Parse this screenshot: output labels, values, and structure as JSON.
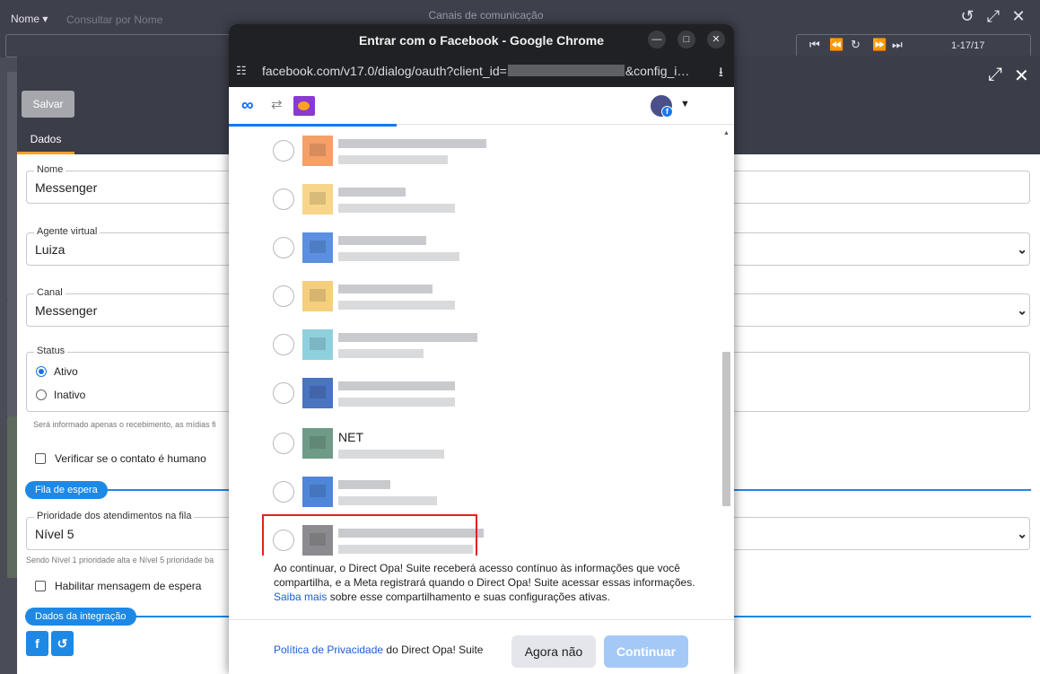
{
  "window": {
    "title": "Canais de comunicação"
  },
  "toolbar": {
    "filter_select": "Nome ▾",
    "filter_placeholder": "Consultar por Nome",
    "pager_count": "1-17/17"
  },
  "form": {
    "save_label": "Salvar",
    "tab_label": "Dados",
    "nome": {
      "label": "Nome",
      "value": "Messenger"
    },
    "agente": {
      "label": "Agente virtual",
      "value": "Luiza"
    },
    "canal": {
      "label": "Canal",
      "value": "Messenger"
    },
    "status": {
      "label": "Status",
      "options": [
        "Ativo",
        "Inativo"
      ],
      "selected": "Ativo",
      "helper": "Será informado apenas o recebimento, as mídias fi"
    },
    "verificar_label": "Verificar se o contato é humano",
    "fila_section": "Fila de espera",
    "prioridade": {
      "label": "Prioridade dos atendimentos na fila",
      "value": "Nível 5",
      "helper": "Sendo Nível 1 prioridade alta e Nível 5 prioridade ba"
    },
    "habilitar_label": "Habilitar mensagem de espera",
    "integracao_section": "Dados da integração"
  },
  "popup": {
    "title": "Entrar com o Facebook - Google Chrome",
    "url_prefix": "facebook.com/v17.0/dialog/oauth?client_id=",
    "url_suffix": "&config_i…",
    "pages": [
      {
        "name": "",
        "thumb_color": "#f4a068"
      },
      {
        "name": "",
        "thumb_color": "#f7d58a"
      },
      {
        "name": "",
        "thumb_color": "#5b8fe0"
      },
      {
        "name": "",
        "thumb_color": "#f5cf7e"
      },
      {
        "name": "",
        "thumb_color": "#8fd0de"
      },
      {
        "name": "",
        "thumb_color": "#4a73c0"
      },
      {
        "name": "NET",
        "thumb_color": "#6f9a88"
      },
      {
        "name": "",
        "thumb_color": "#4f86d8"
      },
      {
        "name": "",
        "thumb_color": "#8c8c90"
      }
    ],
    "consent_text": "Ao continuar, o Direct Opa! Suite receberá acesso contínuo às informações que você compartilha, e a Meta registrará quando o Direct Opa! Suite acessar essas informações.",
    "consent_link": "Saiba mais",
    "consent_tail": "sobre esse compartilhamento e suas configurações ativas.",
    "privacy_link": "Política de Privacidade",
    "privacy_tail": "do Direct Opa! Suite",
    "btn_later": "Agora não",
    "btn_continue": "Continuar"
  },
  "colors": {
    "accent": "#1e88e5",
    "facebook_blue": "#1877f2",
    "highlight": "#e0231d"
  }
}
